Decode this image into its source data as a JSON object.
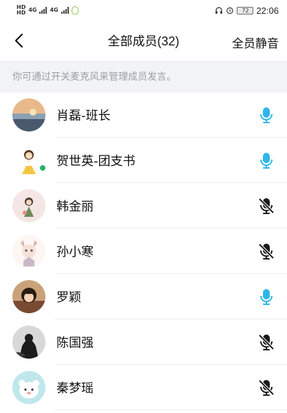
{
  "status_bar": {
    "hd1": "HD",
    "hd2": "HD",
    "net1": "4G",
    "net2": "4G",
    "battery": "72",
    "time": "22:06"
  },
  "header": {
    "title": "全部成员(32)",
    "mute_all": "全员静音"
  },
  "tip": "你可通过开关麦克风来管理成员发言。",
  "members": [
    {
      "name": "肖磊-班长",
      "mic": "on"
    },
    {
      "name": "贺世英-团支书",
      "mic": "on"
    },
    {
      "name": "韩金丽",
      "mic": "off"
    },
    {
      "name": "孙小寒",
      "mic": "off"
    },
    {
      "name": "罗颖",
      "mic": "on"
    },
    {
      "name": "陈国强",
      "mic": "off"
    },
    {
      "name": "秦梦瑶",
      "mic": "off"
    }
  ],
  "colors": {
    "mic_on": "#2eb6ea",
    "mic_off": "#1a1a1a",
    "tip_bg": "#f1f3f5"
  }
}
